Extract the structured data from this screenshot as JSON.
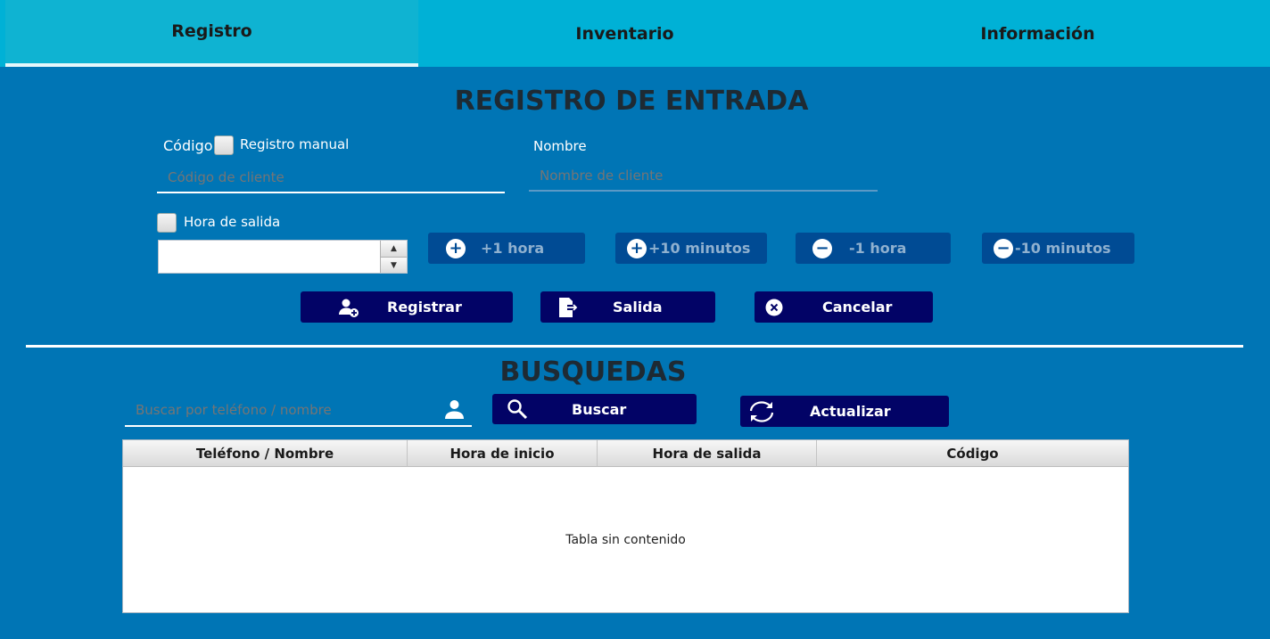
{
  "tabs": [
    {
      "label": "Registro",
      "active": true
    },
    {
      "label": "Inventario",
      "active": false
    },
    {
      "label": "Información",
      "active": false
    }
  ],
  "entry": {
    "title": "REGISTRO DE ENTRADA",
    "codigo_label": "Código",
    "manual_label": "Registro manual",
    "codigo_placeholder": "Código de cliente",
    "nombre_label": "Nombre",
    "nombre_placeholder": "Nombre de cliente",
    "hora_salida_label": "Hora de salida",
    "hora_value": "",
    "adjust_buttons": [
      {
        "label": "+1 hora",
        "icon": "plus-circle-icon"
      },
      {
        "label": "+10 minutos",
        "icon": "plus-circle-icon"
      },
      {
        "label": "-1 hora",
        "icon": "minus-circle-icon"
      },
      {
        "label": "-10 minutos",
        "icon": "minus-circle-icon"
      }
    ],
    "actions": {
      "registrar": "Registrar",
      "salida": "Salida",
      "cancelar": "Cancelar"
    }
  },
  "search": {
    "title": "BUSQUEDAS",
    "placeholder": "Buscar por teléfono / nombre",
    "buscar_label": "Buscar",
    "actualizar_label": "Actualizar"
  },
  "table": {
    "columns": [
      "Teléfono / Nombre",
      "Hora de inicio",
      "Hora de salida",
      "Código"
    ],
    "rows": [],
    "empty_message": "Tabla sin contenido"
  },
  "colors": {
    "background": "#0075b5",
    "tab_bar": "#00b1d6",
    "dark_button": "#020366",
    "muted_button": "#004b94"
  }
}
